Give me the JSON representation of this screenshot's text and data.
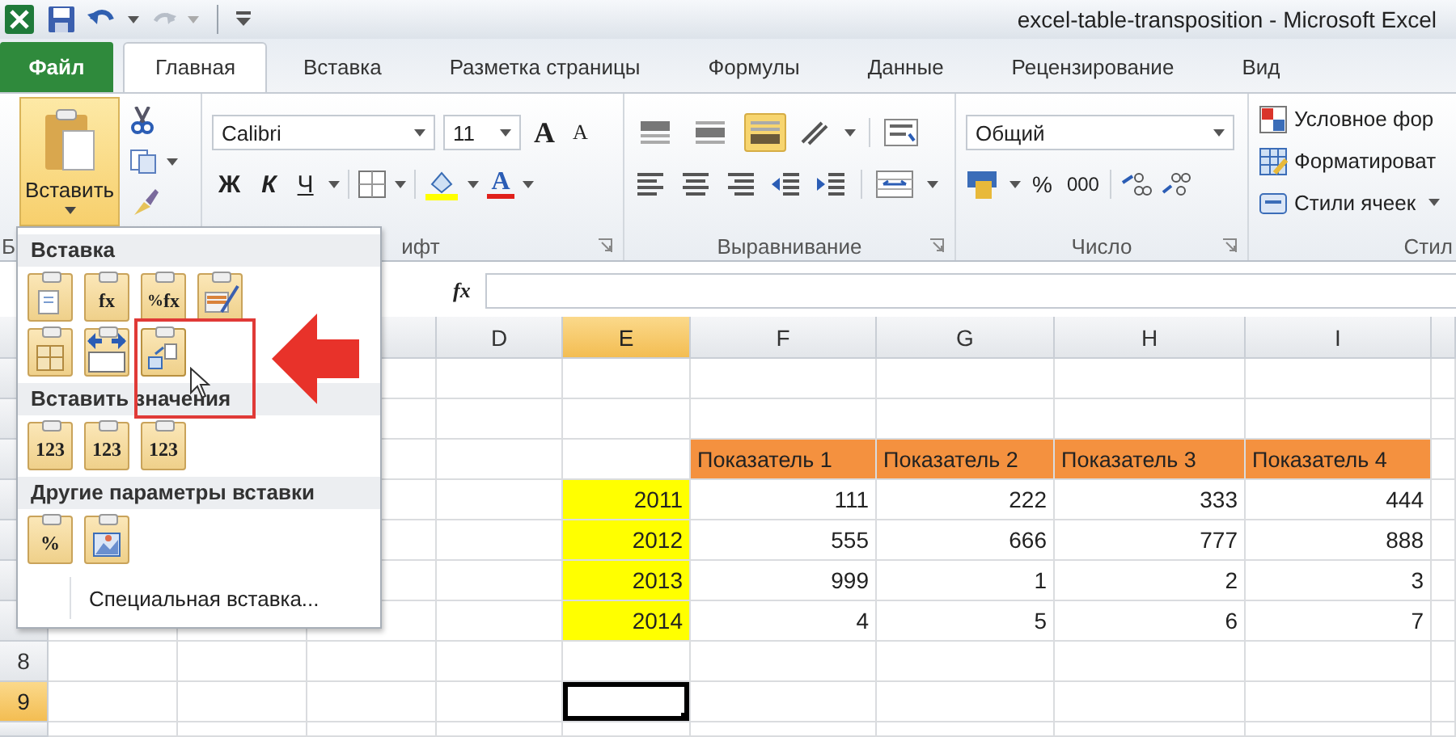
{
  "window": {
    "title": "excel-table-transposition  -  Microsoft Excel"
  },
  "ribbon_tabs": [
    {
      "label": "Файл",
      "kind": "file",
      "selected": false
    },
    {
      "label": "Главная",
      "kind": "tab",
      "selected": true
    },
    {
      "label": "Вставка",
      "kind": "tab",
      "selected": false
    },
    {
      "label": "Разметка страницы",
      "kind": "tab",
      "selected": false
    },
    {
      "label": "Формулы",
      "kind": "tab",
      "selected": false
    },
    {
      "label": "Данные",
      "kind": "tab",
      "selected": false
    },
    {
      "label": "Рецензирование",
      "kind": "tab",
      "selected": false
    },
    {
      "label": "Вид",
      "kind": "tab",
      "selected": false
    }
  ],
  "ribbon": {
    "paste_button": {
      "label": "Вставить",
      "pressed": true
    },
    "font": {
      "name": "Calibri",
      "size": "11",
      "grow": "A",
      "shrink": "A",
      "bold": "Ж",
      "italic": "К",
      "underline": "Ч",
      "color_button": "A"
    },
    "alignment_buttons": [
      {
        "kind": "top",
        "selected": false
      },
      {
        "kind": "middle",
        "selected": false
      },
      {
        "kind": "bottom",
        "selected": true
      }
    ],
    "number": {
      "format": "Общий",
      "percent": "%",
      "thousands": "000"
    },
    "styles": [
      "Условное фор",
      "Форматироват",
      "Стили ячеек"
    ],
    "group_labels": [
      "Б",
      "ифт",
      "Выравнивание",
      "Число",
      "Стил"
    ]
  },
  "formula_bar": {
    "function_label": "fx"
  },
  "sheet": {
    "columns": [
      {
        "label": "D",
        "selected": false
      },
      {
        "label": "E",
        "selected": true
      },
      {
        "label": "F",
        "selected": false
      },
      {
        "label": "G",
        "selected": false
      },
      {
        "label": "H",
        "selected": false
      },
      {
        "label": "I",
        "selected": false
      }
    ],
    "row_headers": [
      {
        "label": "8",
        "selected": false
      },
      {
        "label": "9",
        "selected": true
      }
    ],
    "data_block": {
      "headers": [
        "Показатель 1",
        "Показатель 2",
        "Показатель 3",
        "Показатель 4"
      ],
      "rows": [
        {
          "label": "2011",
          "values": [
            "111",
            "222",
            "333",
            "444"
          ]
        },
        {
          "label": "2012",
          "values": [
            "555",
            "666",
            "777",
            "888"
          ]
        },
        {
          "label": "2013",
          "values": [
            "999",
            "1",
            "2",
            "3"
          ]
        },
        {
          "label": "2014",
          "values": [
            "4",
            "5",
            "6",
            "7"
          ]
        }
      ]
    }
  },
  "paste_menu": {
    "sections": [
      {
        "title": "Вставка",
        "options": [
          {
            "kind": "paste",
            "highlighted": false
          },
          {
            "kind": "formulas",
            "glyph": "fx",
            "highlighted": false
          },
          {
            "kind": "formulas-number",
            "glyph": "$^{%}$fx",
            "highlighted": false
          },
          {
            "kind": "keep-source",
            "highlighted": false
          },
          {
            "kind": "no-borders",
            "highlighted": false
          },
          {
            "kind": "column-widths",
            "highlighted": false
          },
          {
            "kind": "transpose",
            "highlighted": true
          }
        ]
      },
      {
        "title": "Вставить значения",
        "options": [
          {
            "kind": "values",
            "glyph": "123",
            "highlighted": false
          },
          {
            "kind": "values-number",
            "glyph": "123",
            "highlighted": false
          },
          {
            "kind": "values-source",
            "glyph": "123",
            "highlighted": false
          }
        ]
      },
      {
        "title": "Другие параметры вставки",
        "options": [
          {
            "kind": "formatting",
            "glyph": "%",
            "highlighted": false
          },
          {
            "kind": "picture",
            "highlighted": false
          }
        ]
      }
    ],
    "special_item": "Специальная вставка..."
  }
}
